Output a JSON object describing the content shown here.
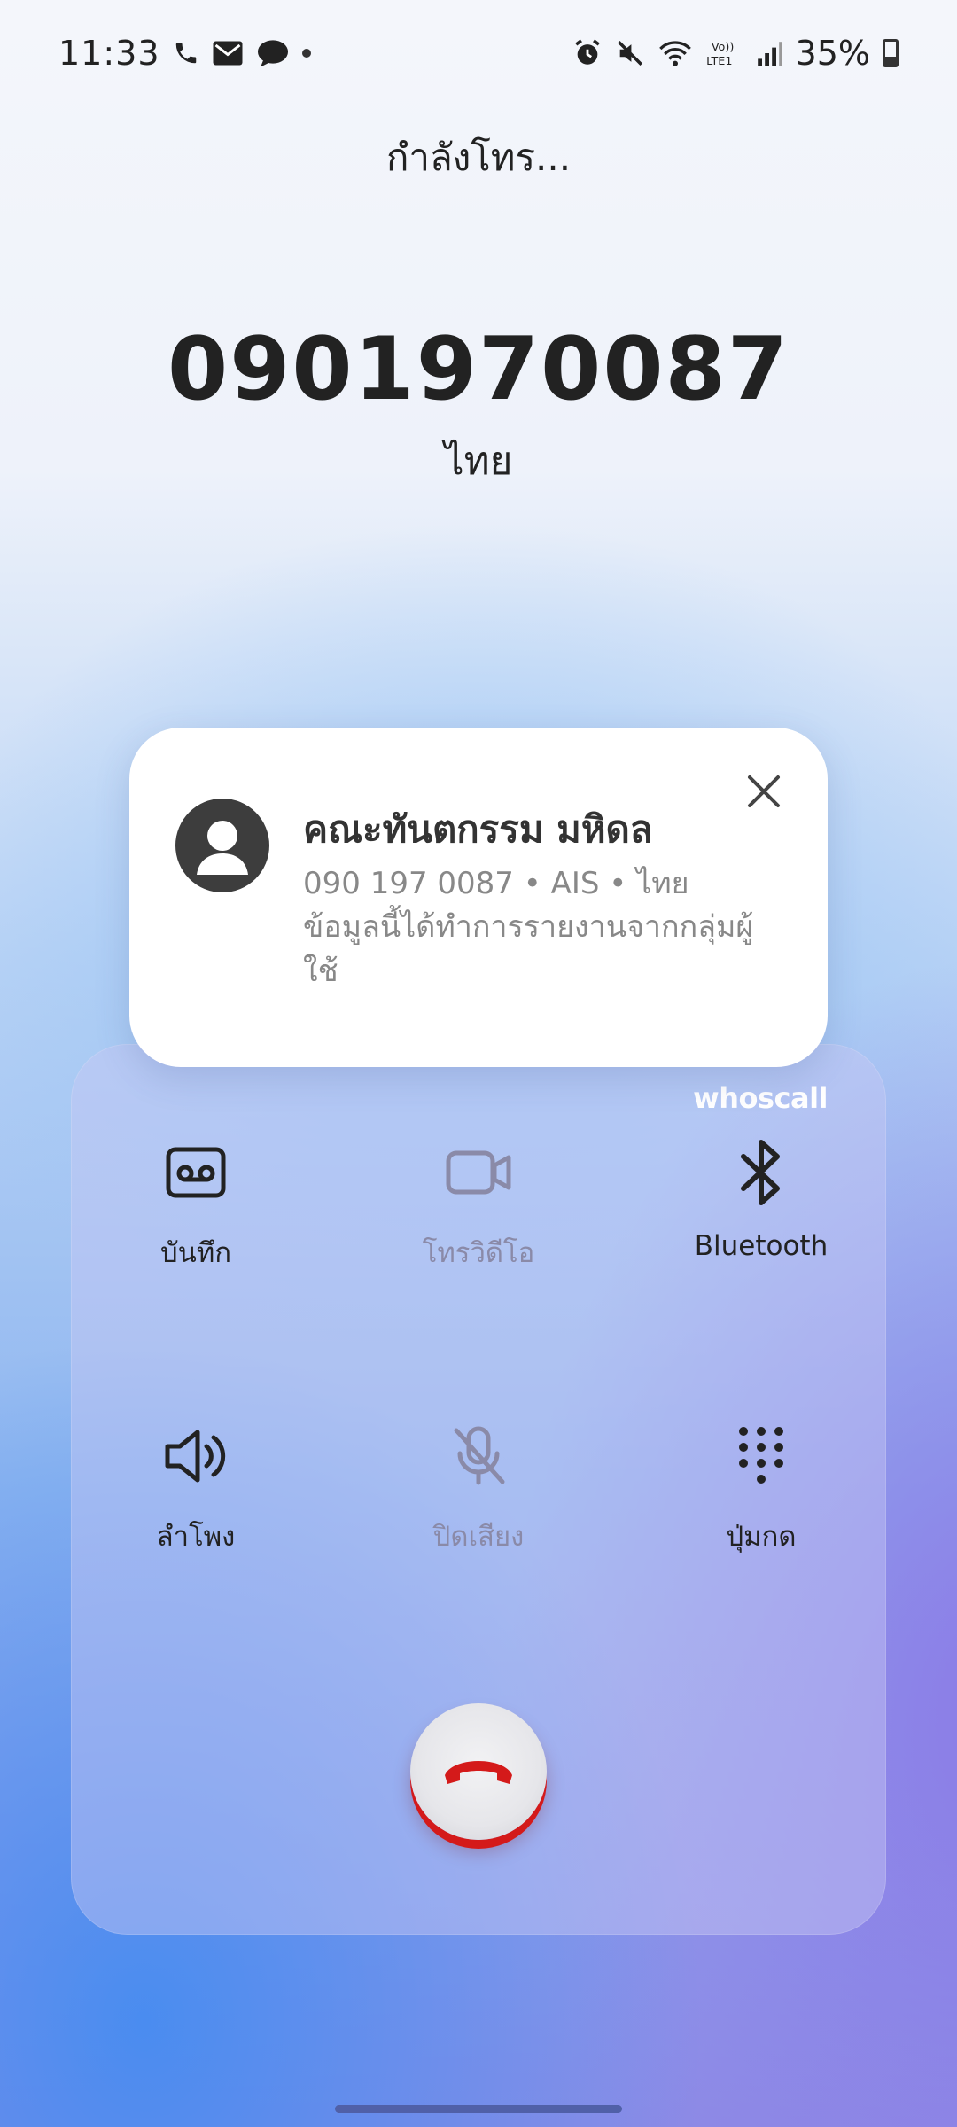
{
  "status_bar": {
    "time": "11:33",
    "battery": "35%",
    "icons": [
      "phone-icon",
      "mail-icon",
      "chat-icon",
      "dot-icon",
      "alarm-icon",
      "mute-icon",
      "wifi-icon",
      "volte-lte-icon",
      "signal-icon",
      "battery-icon"
    ]
  },
  "call": {
    "status": "กำลังโทร...",
    "number": "0901970087",
    "country": "ไทย"
  },
  "card": {
    "name": "คณะทันตกรรม มหิดล",
    "detail": "090 197 0087 • AIS • ไทย",
    "note": "ข้อมูลนี้ได้ทำการรายงานจากกลุ่มผู้ใช้"
  },
  "panel": {
    "brand": "whoscall",
    "buttons": [
      {
        "label": "บันทึก",
        "icon": "voicemail-icon",
        "enabled": true
      },
      {
        "label": "โทรวิดีโอ",
        "icon": "video-call-icon",
        "enabled": false
      },
      {
        "label": "Bluetooth",
        "icon": "bluetooth-icon",
        "enabled": true
      },
      {
        "label": "ลำโพง",
        "icon": "speaker-icon",
        "enabled": true
      },
      {
        "label": "ปิดเสียง",
        "icon": "mic-off-icon",
        "enabled": false
      },
      {
        "label": "ปุ่มกด",
        "icon": "keypad-icon",
        "enabled": true
      }
    ]
  },
  "colors": {
    "end_call": "#d41a1a",
    "icon_dark": "#222222",
    "icon_disabled": "#8a8aa8"
  }
}
